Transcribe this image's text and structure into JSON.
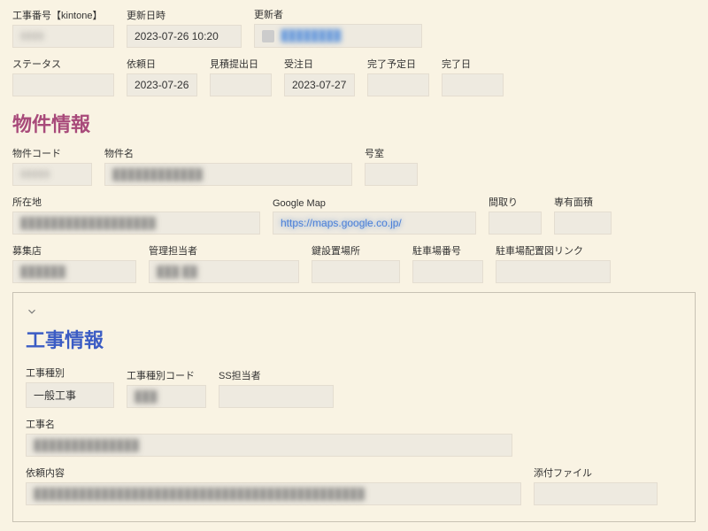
{
  "top": {
    "job_no_label": "工事番号【kintone】",
    "job_no_value": "0000",
    "updated_at_label": "更新日時",
    "updated_at_value": "2023-07-26 10:20",
    "updated_by_label": "更新者",
    "updated_by_value": "████████"
  },
  "dates": {
    "status_label": "ステータス",
    "status_value": "",
    "request_label": "依頼日",
    "request_value": "2023-07-26",
    "estimate_label": "見積提出日",
    "estimate_value": "",
    "order_label": "受注日",
    "order_value": "2023-07-27",
    "planned_label": "完了予定日",
    "planned_value": "",
    "done_label": "完了日",
    "done_value": ""
  },
  "property_section_title": "物件情報",
  "property": {
    "code_label": "物件コード",
    "code_value": "00000",
    "name_label": "物件名",
    "name_value": "████████████",
    "room_label": "号室",
    "room_value": "",
    "address_label": "所在地",
    "address_value": "██████████████████",
    "gmap_label": "Google Map",
    "gmap_value": "https://maps.google.co.jp/",
    "layout_label": "間取り",
    "layout_value": "",
    "area_label": "専有面積",
    "area_value": "",
    "recruit_label": "募集店",
    "recruit_value": "██████",
    "manager_label": "管理担当者",
    "manager_value": "███ ██",
    "key_label": "鍵設置場所",
    "key_value": "",
    "parking_no_label": "駐車場番号",
    "parking_no_value": "",
    "parking_link_label": "駐車場配置図リンク",
    "parking_link_value": ""
  },
  "construction_section_title": "工事情報",
  "construction": {
    "type_label": "工事種別",
    "type_value": "一般工事",
    "type_code_label": "工事種別コード",
    "type_code_value": "███",
    "ss_label": "SS担当者",
    "ss_value": "",
    "name_label": "工事名",
    "name_value": "██████████████",
    "request_label": "依頼内容",
    "request_value": "████████████████████████████████████████████",
    "attach_label": "添付ファイル",
    "attach_value": ""
  }
}
